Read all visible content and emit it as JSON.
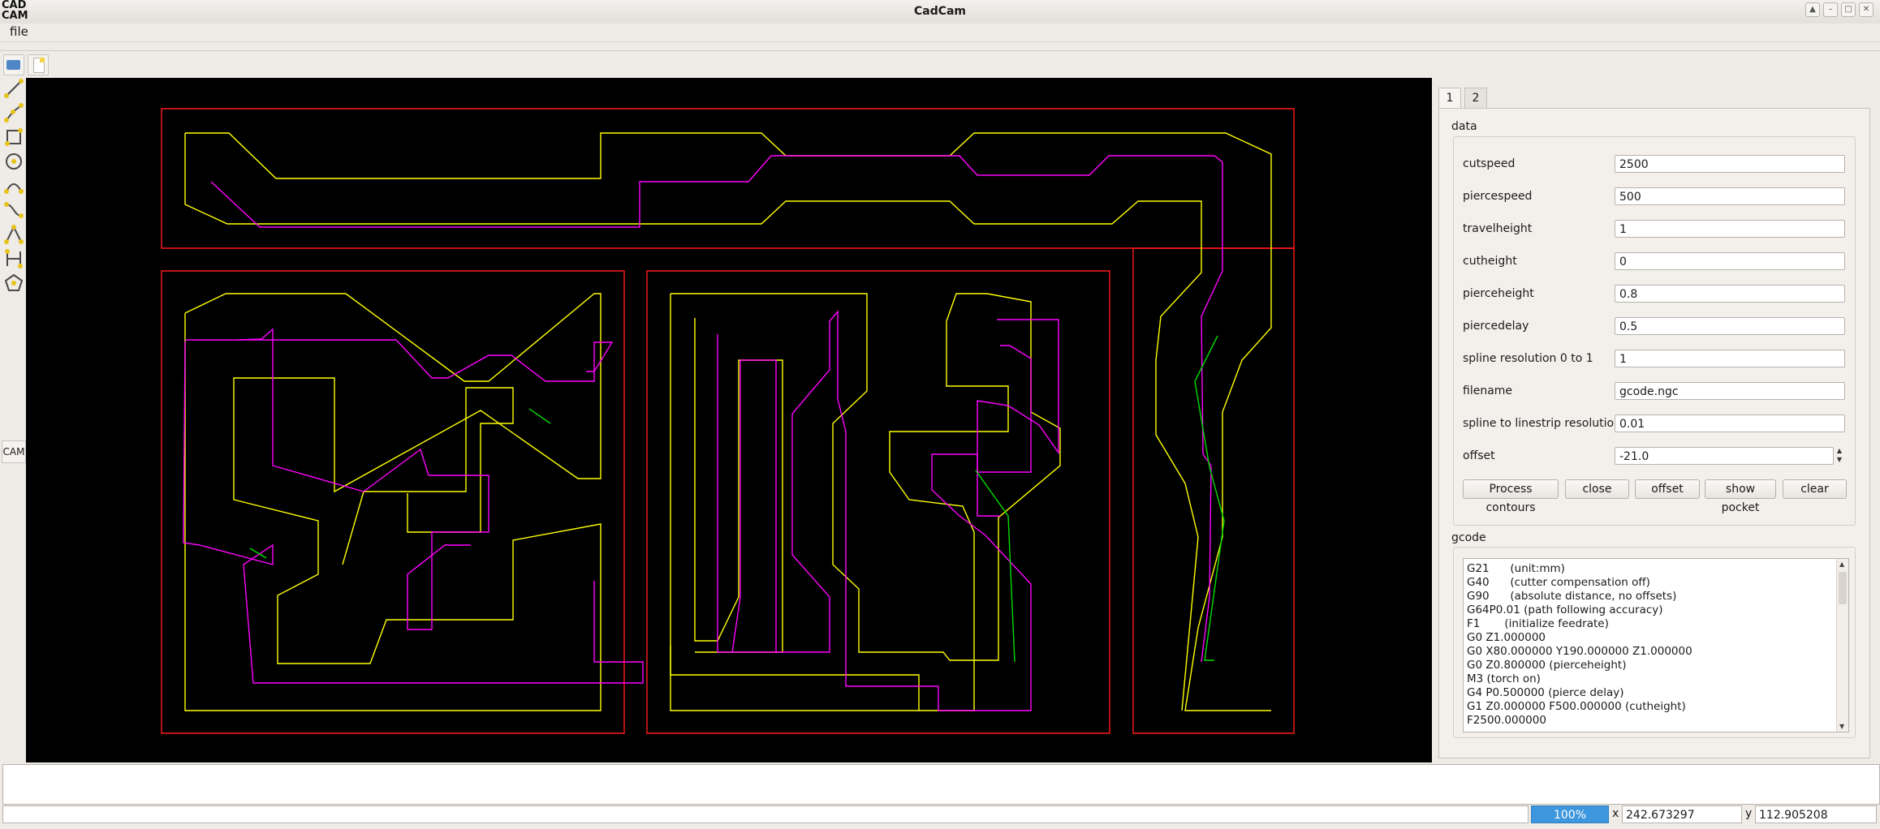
{
  "window": {
    "logo": "CAD\nCAM",
    "title": "CadCam",
    "controls": [
      "▲",
      "–",
      "□",
      "✕"
    ]
  },
  "menu": {
    "file": "file"
  },
  "left_tools": {
    "cam_label": "CAM"
  },
  "panel": {
    "tabs": [
      "1",
      "2"
    ],
    "data_group": "data",
    "fields": [
      {
        "label": "cutspeed",
        "value": "2500"
      },
      {
        "label": "piercespeed",
        "value": "500"
      },
      {
        "label": "travelheight",
        "value": "1"
      },
      {
        "label": "cutheight",
        "value": "0"
      },
      {
        "label": "pierceheight",
        "value": "0.8"
      },
      {
        "label": "piercedelay",
        "value": "0.5"
      },
      {
        "label": "spline resolution 0 to 1",
        "value": "1"
      },
      {
        "label": "filename",
        "value": "gcode.ngc"
      },
      {
        "label": "spline to linestrip resolution",
        "value": "0.01"
      },
      {
        "label": "offset",
        "value": "-21.0"
      }
    ],
    "buttons": [
      "Process contours",
      "close",
      "offset",
      "show pocket",
      "clear"
    ],
    "gcode_group": "gcode",
    "gcode_lines": [
      "G21      (unit:mm)",
      "G40      (cutter compensation off)",
      "G90      (absolute distance, no offsets)",
      "G64P0.01 (path following accuracy)",
      "F1       (initialize feedrate)",
      "G0 Z1.000000",
      "G0 X80.000000 Y190.000000 Z1.000000",
      "G0 Z0.800000 (pierceheight)",
      "M3 (torch on)",
      "G4 P0.500000 (pierce delay)",
      "G1 Z0.000000 F500.000000 (cutheight)",
      "F2500.000000"
    ]
  },
  "status": {
    "zoom": "100%",
    "x_label": "x",
    "x_value": "242.673297",
    "y_label": "y",
    "y_value": "112.905208"
  },
  "colors": {
    "contour": "#ff1a1a",
    "offset": "#ffff00",
    "pocket": "#ff00ff",
    "travel": "#00dd00",
    "zoom_accent": "#3d97de"
  }
}
